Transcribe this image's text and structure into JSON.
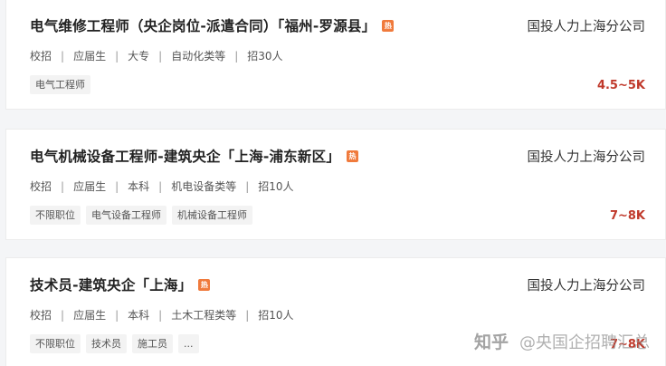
{
  "jobs": [
    {
      "title": "电气维修工程师（央企岗位-派遣合同）「福州-罗源县」",
      "hot_icon": "hot-icon",
      "hot_label": "热",
      "company": "国投人力上海分公司",
      "meta": [
        "校招",
        "应届生",
        "大专",
        "自动化类等",
        "招30人"
      ],
      "tags": [
        "电气工程师"
      ],
      "salary": "4.5~5K"
    },
    {
      "title": "电气机械设备工程师-建筑央企「上海-浦东新区」",
      "hot_icon": "hot-icon",
      "hot_label": "热",
      "company": "国投人力上海分公司",
      "meta": [
        "校招",
        "应届生",
        "本科",
        "机电设备类等",
        "招10人"
      ],
      "tags": [
        "不限职位",
        "电气设备工程师",
        "机械设备工程师"
      ],
      "salary": "7~8K"
    },
    {
      "title": "技术员-建筑央企「上海」",
      "hot_icon": "hot-icon",
      "hot_label": "热",
      "company": "国投人力上海分公司",
      "meta": [
        "校招",
        "应届生",
        "本科",
        "土木工程类等",
        "招10人"
      ],
      "tags": [
        "不限职位",
        "技术员",
        "施工员",
        "..."
      ],
      "salary": "7~8K"
    }
  ],
  "meta_separator": "|",
  "watermark": {
    "logo": "知乎",
    "text": "@央国企招聘汇总"
  },
  "colors": {
    "salary": "#c0392b",
    "hot_badge": "#f07a3c",
    "title": "#222222"
  }
}
